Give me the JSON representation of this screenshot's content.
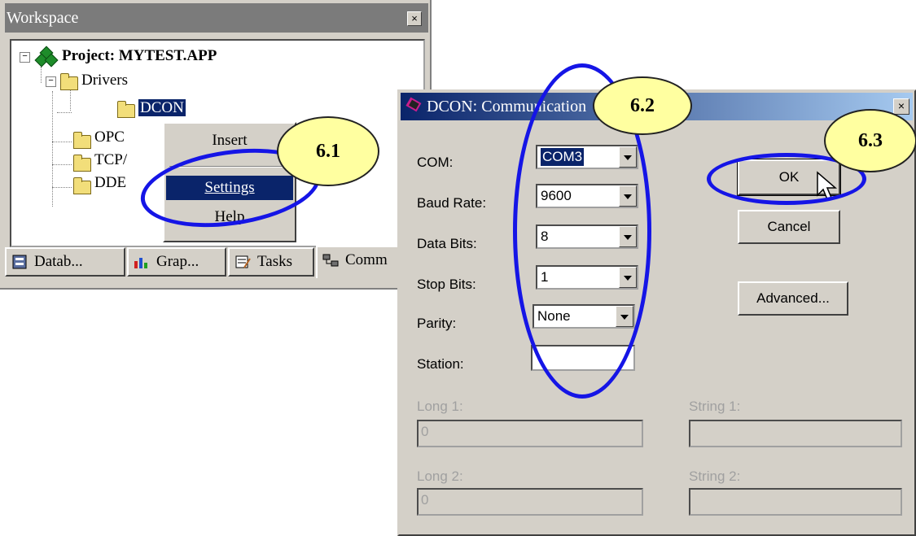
{
  "workspace": {
    "title": "Workspace",
    "close": "×",
    "tree": {
      "project": "Project: MYTEST.APP",
      "drivers": "Drivers",
      "dcon": "DCON",
      "opc": "OPC",
      "tcp": "TCP/",
      "dde": "DDE"
    },
    "tabs": [
      "Datab...",
      "Grap...",
      "Tasks",
      "Comm"
    ]
  },
  "context_menu": {
    "items": [
      "Insert",
      "Settings",
      "Help"
    ],
    "highlighted": "Settings"
  },
  "dialog": {
    "title": "DCON: Communication",
    "close": "×",
    "fields": {
      "com": {
        "label": "COM:",
        "value": "COM3"
      },
      "baud_rate": {
        "label": "Baud Rate:",
        "value": "9600"
      },
      "data_bits": {
        "label": "Data Bits:",
        "value": "8"
      },
      "stop_bits": {
        "label": "Stop Bits:",
        "value": "1"
      },
      "parity": {
        "label": "Parity:",
        "value": "None"
      },
      "station": {
        "label": "Station:",
        "value": ""
      }
    },
    "long1": {
      "label": "Long 1:",
      "value": "0"
    },
    "long2": {
      "label": "Long 2:",
      "value": "0"
    },
    "string1": {
      "label": "String 1:",
      "value": ""
    },
    "string2": {
      "label": "String 2:",
      "value": ""
    },
    "buttons": {
      "ok": "OK",
      "cancel": "Cancel",
      "advanced": "Advanced..."
    }
  },
  "annotations": {
    "step1": "6.1",
    "step2": "6.2",
    "step3": "6.3"
  },
  "colors": {
    "callout_fill": "#ffffa0",
    "ring": "#1515e6",
    "selection": "#0a246a"
  }
}
